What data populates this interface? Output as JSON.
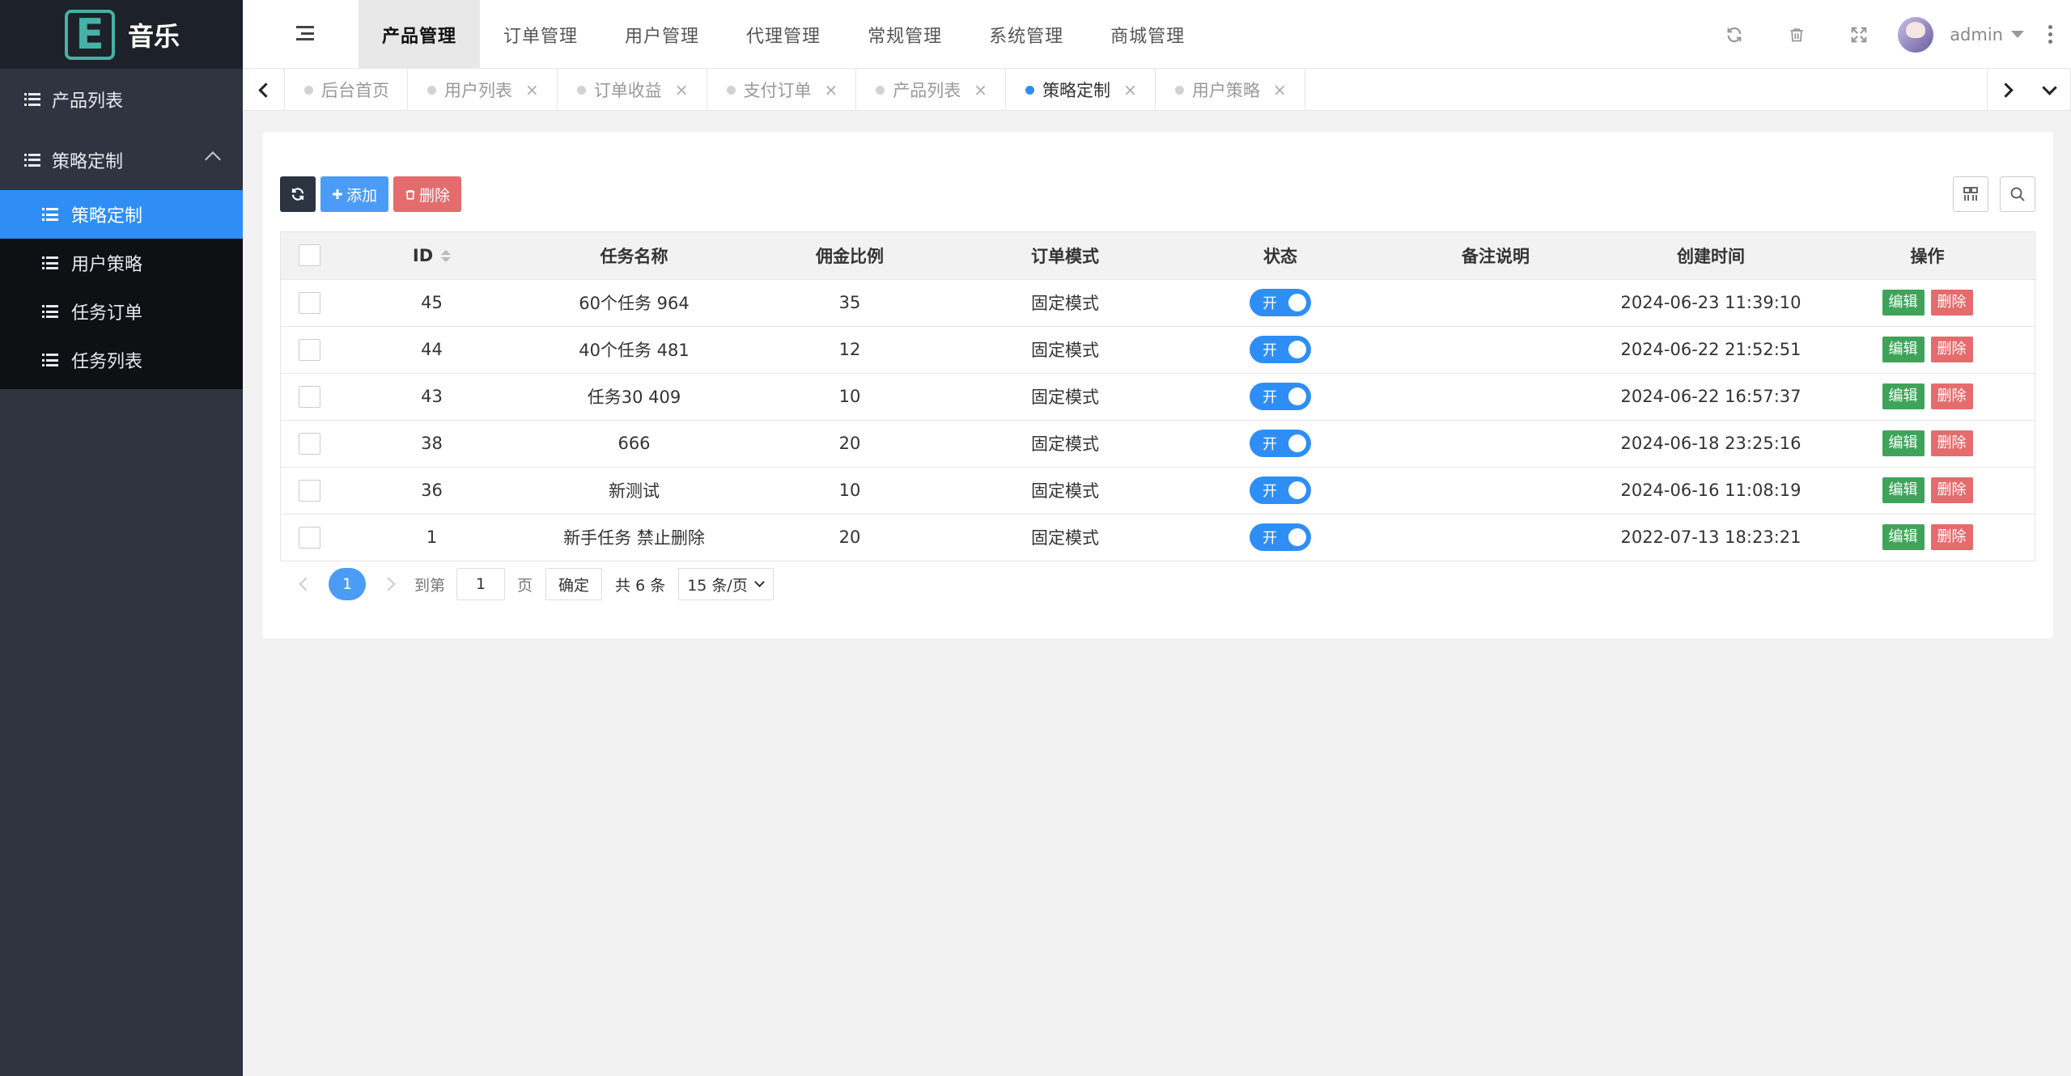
{
  "app": {
    "logo_letter": "E",
    "logo_text": "音乐"
  },
  "sidebar": {
    "items": [
      {
        "label": "产品列表"
      },
      {
        "label": "策略定制"
      }
    ],
    "submenu": [
      {
        "label": "策略定制",
        "active": true
      },
      {
        "label": "用户策略"
      },
      {
        "label": "任务订单"
      },
      {
        "label": "任务列表"
      }
    ]
  },
  "topnav": {
    "items": [
      "产品管理",
      "订单管理",
      "用户管理",
      "代理管理",
      "常规管理",
      "系统管理",
      "商城管理"
    ],
    "active_index": 0,
    "username": "admin"
  },
  "tabs": [
    {
      "label": "后台首页",
      "closable": false
    },
    {
      "label": "用户列表",
      "closable": true
    },
    {
      "label": "订单收益",
      "closable": true
    },
    {
      "label": "支付订单",
      "closable": true
    },
    {
      "label": "产品列表",
      "closable": true
    },
    {
      "label": "策略定制",
      "closable": true,
      "active": true
    },
    {
      "label": "用户策略",
      "closable": true
    }
  ],
  "toolbar": {
    "add_label": "添加",
    "delete_label": "删除"
  },
  "table": {
    "headers": [
      "ID",
      "任务名称",
      "佣金比例",
      "订单模式",
      "状态",
      "备注说明",
      "创建时间",
      "操作"
    ],
    "rows": [
      {
        "id": "45",
        "name": "60个任务 964",
        "rate": "35",
        "mode": "固定模式",
        "status": "开",
        "remark": "",
        "created": "2024-06-23 11:39:10"
      },
      {
        "id": "44",
        "name": "40个任务 481",
        "rate": "12",
        "mode": "固定模式",
        "status": "开",
        "remark": "",
        "created": "2024-06-22 21:52:51"
      },
      {
        "id": "43",
        "name": "任务30 409",
        "rate": "10",
        "mode": "固定模式",
        "status": "开",
        "remark": "",
        "created": "2024-06-22 16:57:37"
      },
      {
        "id": "38",
        "name": "666",
        "rate": "20",
        "mode": "固定模式",
        "status": "开",
        "remark": "",
        "created": "2024-06-18 23:25:16"
      },
      {
        "id": "36",
        "name": "新测试",
        "rate": "10",
        "mode": "固定模式",
        "status": "开",
        "remark": "",
        "created": "2024-06-16 11:08:19"
      },
      {
        "id": "1",
        "name": "新手任务 禁止删除",
        "rate": "20",
        "mode": "固定模式",
        "status": "开",
        "remark": "",
        "created": "2022-07-13 18:23:21"
      }
    ],
    "edit_label": "编辑",
    "delete_label": "删除"
  },
  "pager": {
    "current": "1",
    "goto_label": "到第",
    "page_value": "1",
    "page_unit": "页",
    "confirm_label": "确定",
    "total_label": "共 6 条",
    "page_size": "15 条/页"
  },
  "colors": {
    "primary": "#2e8ef6",
    "sidebar_bg": "#2f3440",
    "danger": "#e46c6c",
    "success": "#3fa45a"
  }
}
